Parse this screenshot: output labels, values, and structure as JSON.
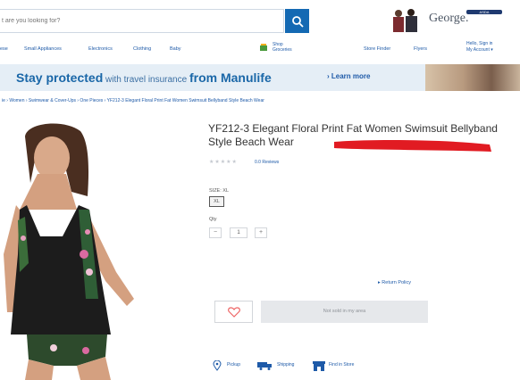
{
  "header": {
    "search_placeholder": "t are you looking for?",
    "logo_text": "George.",
    "logo_badge": "ASDA"
  },
  "nav": {
    "items": [
      "ese",
      "Small Appliances",
      "Electronics",
      "Clothing",
      "Baby"
    ],
    "shop_line1": "Shop",
    "shop_line2": "Groceries",
    "store_finder": "Store Finder",
    "flyers": "Flyers",
    "hello_line1": "Hello, Sign in",
    "hello_line2": "My Account ▾"
  },
  "banner": {
    "lead": "Stay protected",
    "mid": " with travel insurance ",
    "brand": "from Manulife",
    "cta": "› Learn more"
  },
  "breadcrumb": "ie  ›  Women  ›  Swimwear & Cover-Ups  ›  One Pieces  ›  YF212-3 Elegant Floral Print Fat Women Swimsuit Bellyband Style Beach Wear",
  "product": {
    "title": "YF212-3 Elegant Floral Print Fat Women Swimsuit Bellyband Style Beach Wear",
    "stars": "★★★★★",
    "reviews": "0.0 Reviews",
    "size_label": "SIZE: XL",
    "size_value": "XL",
    "qty_label": "Qty",
    "qty_value": "1",
    "qty_minus": "−",
    "qty_plus": "+",
    "return_policy": "Return Policy",
    "add_label": "Not sold in my area"
  },
  "footer": {
    "pickup": "Pickup",
    "shipping": "Shipping",
    "find_store": "Find in Store"
  },
  "colors": {
    "accent": "#1469b3",
    "link": "#1e5aa8",
    "redline": "#e11b22"
  }
}
